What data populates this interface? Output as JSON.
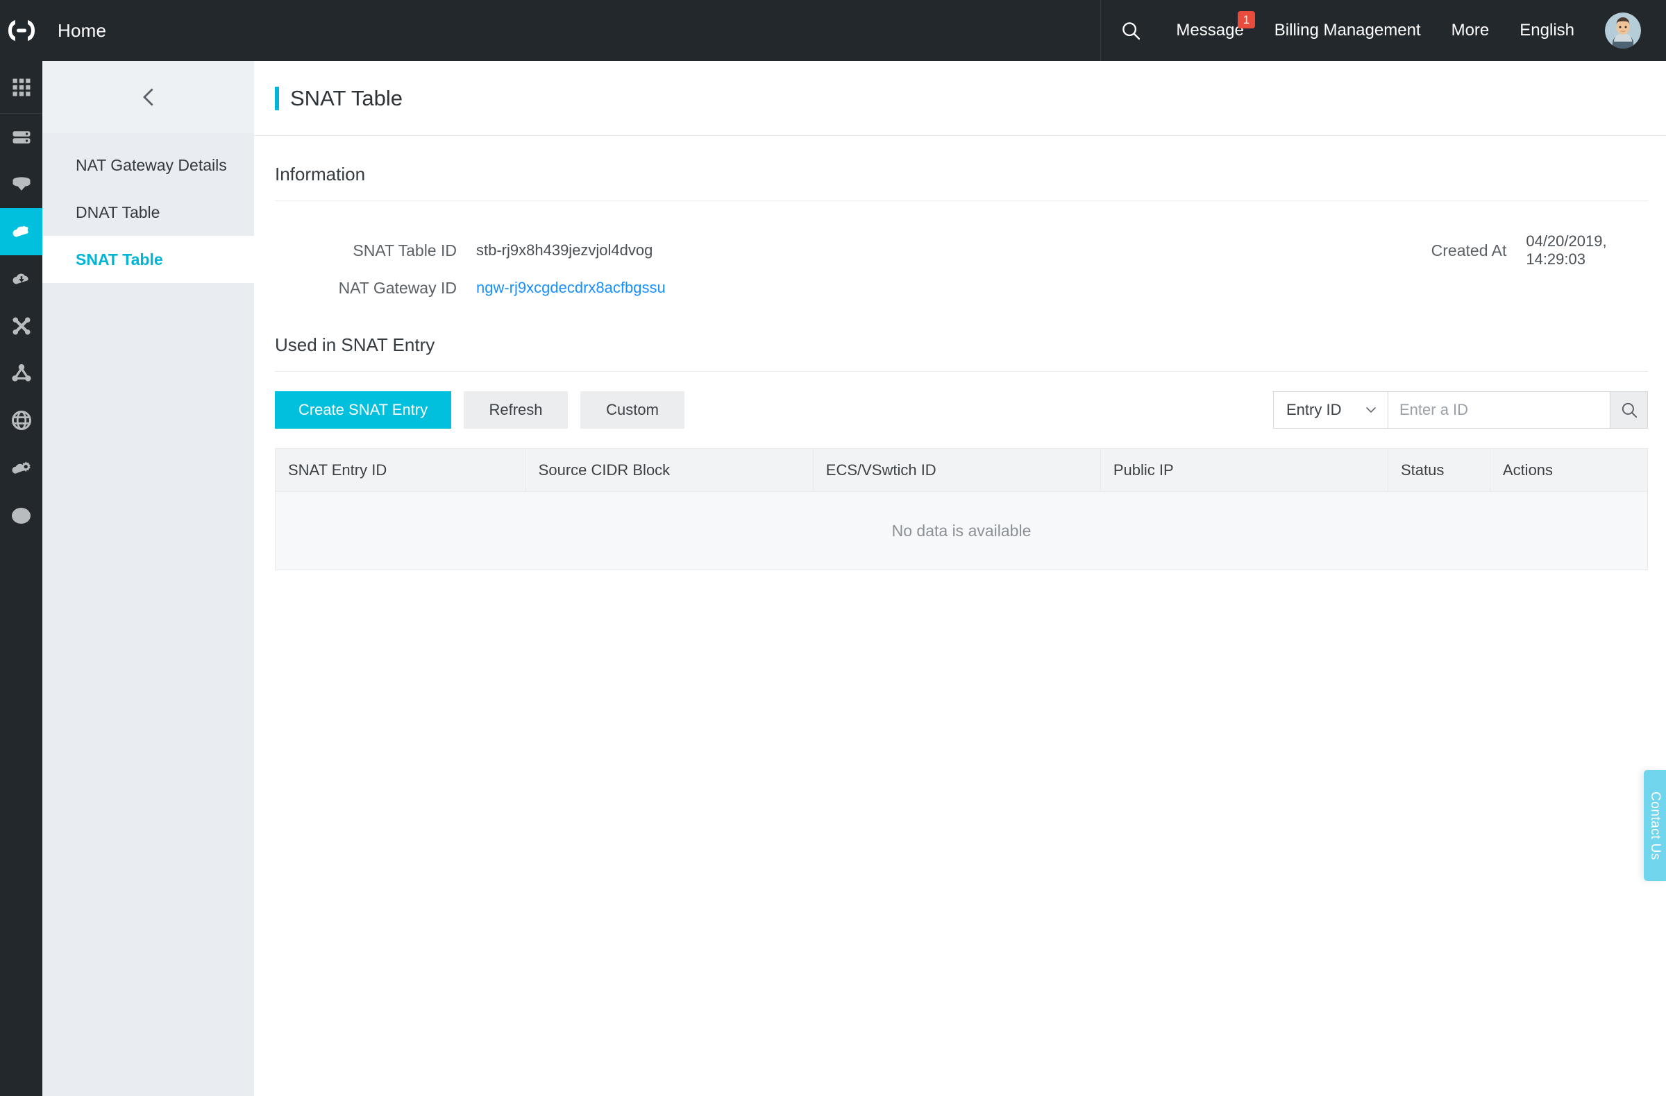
{
  "header": {
    "logo_icon": "alibaba-cloud-logo-icon",
    "home_label": "Home",
    "search_icon": "search-icon",
    "message_label": "Message",
    "message_badge": "1",
    "billing_label": "Billing Management",
    "more_label": "More",
    "language_label": "English",
    "avatar_icon": "user-avatar"
  },
  "rail": {
    "items": [
      {
        "icon": "apps-grid-icon",
        "active": false
      },
      {
        "icon": "server-icon",
        "active": false
      },
      {
        "icon": "database-icon",
        "active": false
      },
      {
        "icon": "cloud-network-icon",
        "active": true
      },
      {
        "icon": "cloud-upload-icon",
        "active": false
      },
      {
        "icon": "cross-connect-icon",
        "active": false
      },
      {
        "icon": "share-nodes-icon",
        "active": false
      },
      {
        "icon": "globe-icon",
        "active": false
      },
      {
        "icon": "cloud-settings-icon",
        "active": false
      },
      {
        "icon": "circle-icon",
        "active": false
      }
    ]
  },
  "nav": {
    "collapse_icon": "chevron-left-icon",
    "items": [
      {
        "label": "NAT Gateway Details",
        "active": false
      },
      {
        "label": "DNAT Table",
        "active": false
      },
      {
        "label": "SNAT Table",
        "active": true
      }
    ]
  },
  "page": {
    "title": "SNAT Table",
    "accent_color": "#00b5d6"
  },
  "information": {
    "section_title": "Information",
    "fields": [
      {
        "label": "SNAT Table ID",
        "value": "stb-rj9x8h439jezvjol4dvog",
        "is_link": false
      },
      {
        "label": "NAT Gateway ID",
        "value": "ngw-rj9xcgdecdrx8acfbgssu",
        "is_link": true
      }
    ],
    "created_at_label": "Created At",
    "created_at_value": "04/20/2019, 14:29:03"
  },
  "entries": {
    "section_title": "Used in SNAT Entry",
    "create_label": "Create SNAT Entry",
    "refresh_label": "Refresh",
    "custom_label": "Custom",
    "filter_selected": "Entry ID",
    "filter_chevron_icon": "chevron-down-icon",
    "search_placeholder": "Enter a ID",
    "search_value": "",
    "search_icon": "search-icon",
    "columns": [
      "SNAT Entry ID",
      "Source CIDR Block",
      "ECS/VSwtich ID",
      "Public IP",
      "Status",
      "Actions"
    ],
    "rows": [],
    "empty_message": "No data is available"
  },
  "contact": {
    "label": "Contact Us"
  }
}
